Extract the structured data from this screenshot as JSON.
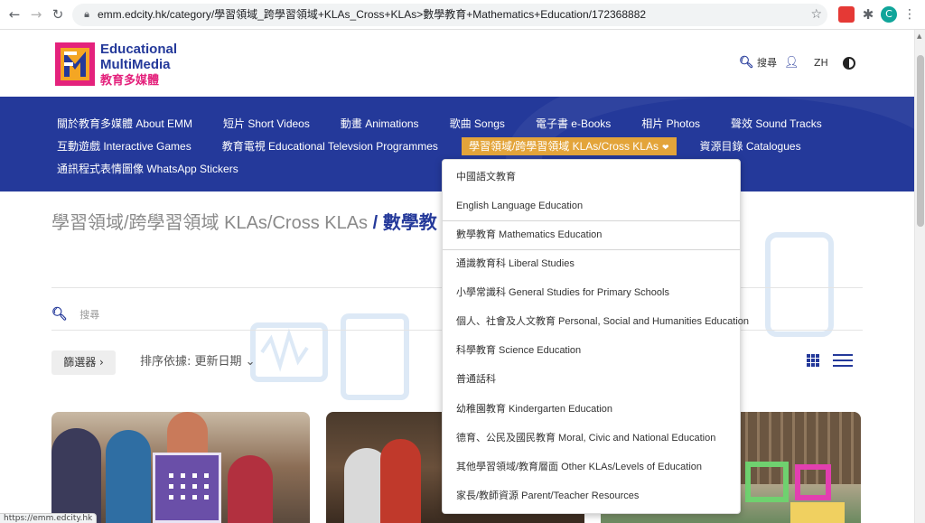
{
  "browser": {
    "url": "emm.edcity.hk/category/學習領域_跨學習領域+KLAs_Cross+KLAs>數學教育+Mathematics+Education/172368882",
    "profile_initial": "C",
    "status_text": "https://emm.edcity.hk"
  },
  "header": {
    "logo_line1": "Educational",
    "logo_line2": "MultiMedia",
    "logo_line3": "教育多媒體",
    "search_label": "搜尋",
    "lang_label": "ZH"
  },
  "nav": {
    "row1": [
      "關於教育多媒體 About EMM",
      "短片 Short Videos",
      "動畫 Animations",
      "歌曲 Songs",
      "電子書 e-Books",
      "相片 Photos",
      "聲效 Sound Tracks"
    ],
    "row2_left": [
      "互動遊戲 Interactive Games",
      "教育電視 Educational Televsion Programmes"
    ],
    "row2_active": "學習領域/跨學習領域 KLAs/Cross KLAs",
    "row2_right": [
      "資源目錄 Catalogues"
    ],
    "row3": [
      "通訊程式表情圖像 WhatsApp Stickers"
    ]
  },
  "breadcrumb": {
    "crumb1": "學習領域/跨學習領域 KLAs/Cross KLAs",
    "separator": "/",
    "crumb2": "數學教"
  },
  "search": {
    "placeholder": "搜尋"
  },
  "toolbar": {
    "filter_label": "篩選器 ›",
    "sort_label": "排序依據: 更新日期 ⌄"
  },
  "dropdown": {
    "items": [
      "中國語文教育",
      "English Language Education",
      "數學教育 Mathematics Education",
      "通識教育科 Liberal Studies",
      "小學常識科 General Studies for Primary Schools",
      "個人、社會及人文教育 Personal, Social and Humanities Education",
      "科學教育 Science Education",
      "普通話科",
      "幼稚園教育 Kindergarten Education",
      "德育、公民及國民教育 Moral, Civic and National Education",
      "其他學習領域/教育層面 Other KLAs/Levels of Education",
      "家長/教師資源 Parent/Teacher Resources"
    ]
  },
  "colors": {
    "brand_blue": "#24399a",
    "brand_pink": "#e4227c",
    "active_nav": "#e3a43a"
  }
}
